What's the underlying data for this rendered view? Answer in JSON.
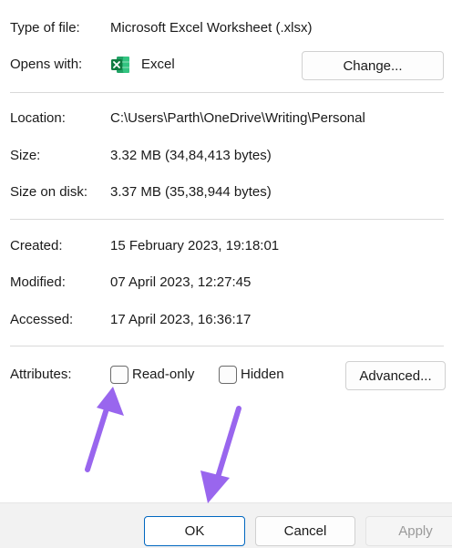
{
  "file_info": {
    "type_label": "Type of file:",
    "type_value": "Microsoft Excel Worksheet (.xlsx)",
    "opens_label": "Opens with:",
    "opens_app": "Excel",
    "opens_icon": "excel-icon",
    "change_button": "Change..."
  },
  "location_info": {
    "location_label": "Location:",
    "location_value": "C:\\Users\\Parth\\OneDrive\\Writing\\Personal",
    "size_label": "Size:",
    "size_value": "3.32 MB (34,84,413 bytes)",
    "size_on_disk_label": "Size on disk:",
    "size_on_disk_value": "3.37 MB (35,38,944 bytes)"
  },
  "dates": {
    "created_label": "Created:",
    "created_value": "15 February 2023, 19:18:01",
    "modified_label": "Modified:",
    "modified_value": "07 April 2023, 12:27:45",
    "accessed_label": "Accessed:",
    "accessed_value": "17 April 2023, 16:36:17"
  },
  "attributes": {
    "label": "Attributes:",
    "read_only_label": "Read-only",
    "read_only_checked": false,
    "hidden_label": "Hidden",
    "hidden_checked": false,
    "advanced_button": "Advanced..."
  },
  "footer": {
    "ok_label": "OK",
    "cancel_label": "Cancel",
    "apply_label": "Apply",
    "apply_enabled": false
  },
  "colors": {
    "accent": "#0067c0",
    "annotation_arrow": "#9966ee",
    "excel_green": "#107c41"
  }
}
